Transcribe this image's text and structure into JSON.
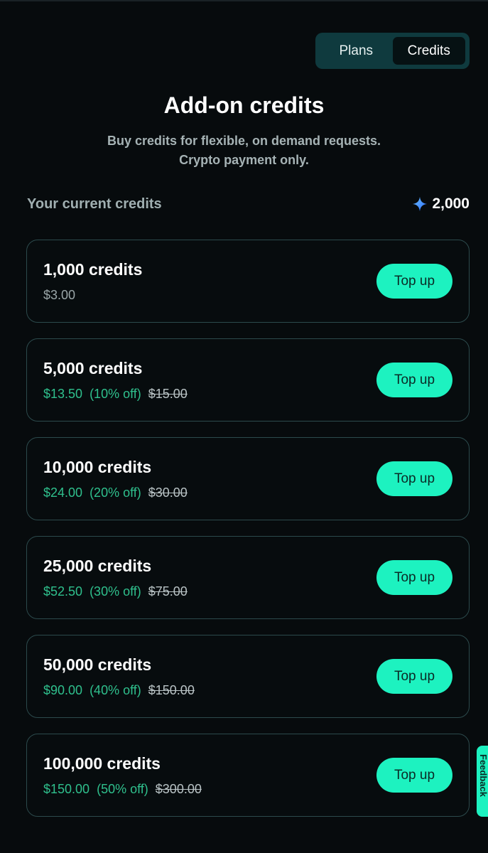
{
  "toggle": {
    "plans_label": "Plans",
    "credits_label": "Credits",
    "active": "Credits"
  },
  "header": {
    "title": "Add-on credits",
    "subtitle_line1": "Buy credits for flexible, on demand requests.",
    "subtitle_line2": "Crypto payment only."
  },
  "current": {
    "label": "Your current credits",
    "value": "2,000",
    "icon": "sparkle-icon"
  },
  "packages": [
    {
      "name": "1,000 credits",
      "price": "$3.00",
      "discount": "",
      "original": "",
      "button": "Top up"
    },
    {
      "name": "5,000 credits",
      "price": "$13.50",
      "discount": "(10% off)",
      "original": "$15.00",
      "button": "Top up"
    },
    {
      "name": "10,000 credits",
      "price": "$24.00",
      "discount": "(20% off)",
      "original": "$30.00",
      "button": "Top up"
    },
    {
      "name": "25,000 credits",
      "price": "$52.50",
      "discount": "(30% off)",
      "original": "$75.00",
      "button": "Top up"
    },
    {
      "name": "50,000 credits",
      "price": "$90.00",
      "discount": "(40% off)",
      "original": "$150.00",
      "button": "Top up"
    },
    {
      "name": "100,000 credits",
      "price": "$150.00",
      "discount": "(50% off)",
      "original": "$300.00",
      "button": "Top up"
    }
  ],
  "feedback": {
    "label": "Feedback"
  },
  "colors": {
    "accent": "#1df2c0",
    "discount": "#2fc08d",
    "background": "#070b0d"
  }
}
